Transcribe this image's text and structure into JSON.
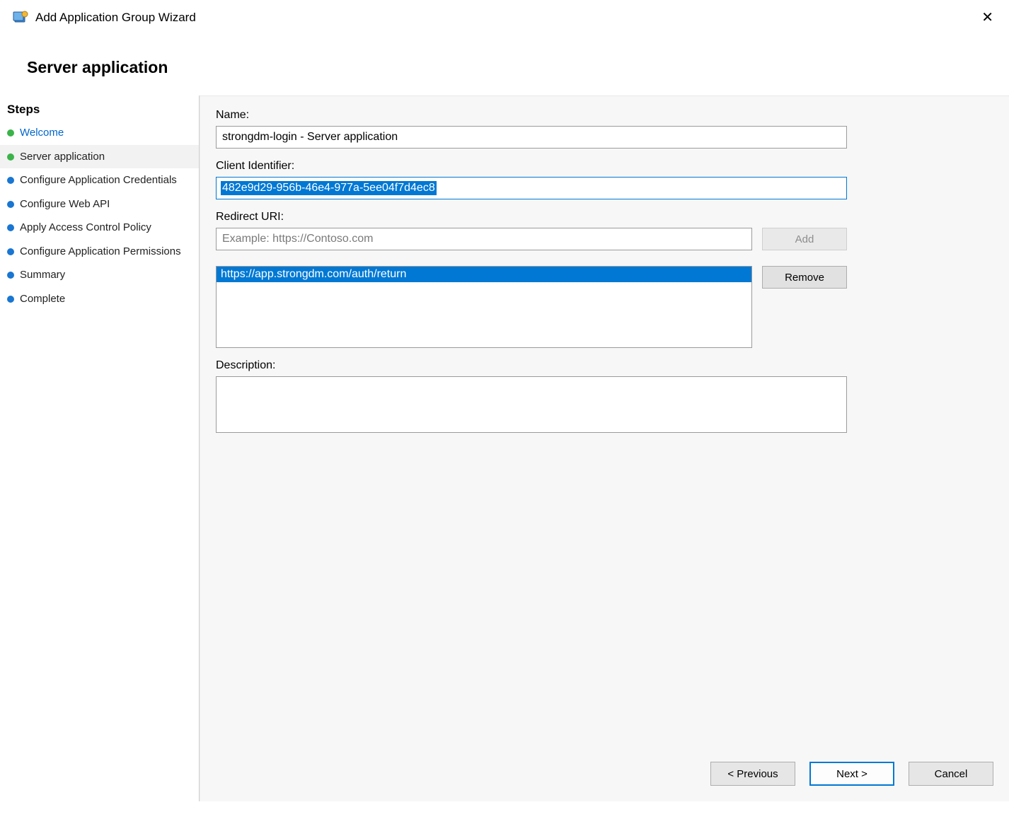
{
  "window": {
    "title": "Add Application Group Wizard",
    "close_label": "✕"
  },
  "heading": "Server application",
  "steps": {
    "title": "Steps",
    "items": [
      {
        "label": "Welcome",
        "status": "done",
        "link": true
      },
      {
        "label": "Server application",
        "status": "done",
        "link": false,
        "active": true
      },
      {
        "label": "Configure Application Credentials",
        "status": "pending",
        "link": false
      },
      {
        "label": "Configure Web API",
        "status": "pending",
        "link": false
      },
      {
        "label": "Apply Access Control Policy",
        "status": "pending",
        "link": false
      },
      {
        "label": "Configure Application Permissions",
        "status": "pending",
        "link": false
      },
      {
        "label": "Summary",
        "status": "pending",
        "link": false
      },
      {
        "label": "Complete",
        "status": "pending",
        "link": false
      }
    ]
  },
  "form": {
    "name_label": "Name:",
    "name_value": "strongdm-login - Server application",
    "client_id_label": "Client Identifier:",
    "client_id_value": "482e9d29-956b-46e4-977a-5ee04f7d4ec8",
    "redirect_label": "Redirect URI:",
    "redirect_placeholder": "Example: https://Contoso.com",
    "add_button": "Add",
    "remove_button": "Remove",
    "redirect_uris": [
      "https://app.strongdm.com/auth/return"
    ],
    "description_label": "Description:",
    "description_value": ""
  },
  "footer": {
    "previous": "< Previous",
    "next": "Next >",
    "cancel": "Cancel"
  }
}
